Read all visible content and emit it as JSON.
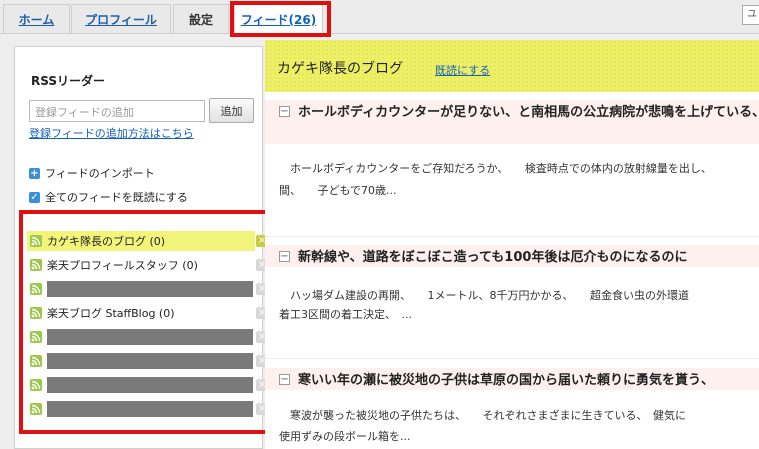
{
  "tabs": [
    {
      "label": "ホーム"
    },
    {
      "label": "プロフィール"
    },
    {
      "label": "設定"
    },
    {
      "label": "フィード(26)"
    }
  ],
  "tab_right_text": "ユ",
  "sidebar": {
    "title": "RSSリーダー",
    "input_placeholder": "登録フィードの追加",
    "add_button": "追加",
    "howto_link": "登録フィードの追加方法はこちら",
    "import_label": "フィードのインポート",
    "mark_all_label": "全てのフィードを既読にする",
    "feeds": [
      {
        "label": "カゲキ隊長のブログ (0)",
        "redacted": false,
        "active": true
      },
      {
        "label": "楽天プロフィールスタッフ (0)",
        "redacted": false,
        "active": false
      },
      {
        "label": "",
        "redacted": true,
        "active": false
      },
      {
        "label": "楽天ブログ StaffBlog (0)",
        "redacted": false,
        "active": false
      },
      {
        "label": "",
        "redacted": true,
        "active": false
      },
      {
        "label": "",
        "redacted": true,
        "active": false
      },
      {
        "label": "",
        "redacted": true,
        "active": false
      },
      {
        "label": "",
        "redacted": true,
        "active": false
      }
    ]
  },
  "main": {
    "feed_title": "カゲキ隊長のブログ",
    "mark_read": "既読にする",
    "articles": [
      {
        "title": "ホールボディカウンターが足りない、と南相馬の公立病院が悲鳴を上げている、",
        "body_line1": "　ホールボディカウンターをご存知だろうか、　　検査時点での体内の放射線量を出し、",
        "body_line2": "間、　　子どもで70歳..."
      },
      {
        "title": "新幹線や、道路をぼこぼこ造っても100年後は厄介ものになるのに",
        "body_line1": "　ハッ場ダム建設の再開、　　1メートル、8千万円かかる、　　超金食い虫の外環道",
        "body_line2": "着工3区間の着工決定、　..."
      },
      {
        "title": "寒いい年の瀬に被災地の子供は草原の国から届いた頼りに勇気を貰う、",
        "body_line1": "　寒波が襲った被災地の子供たちは、　　それぞれさまざまに生きている、　健気に",
        "body_line2": "使用ずみの段ボール箱を..."
      }
    ]
  }
}
